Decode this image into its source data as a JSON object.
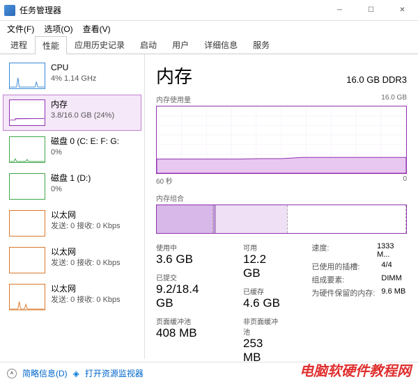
{
  "window": {
    "title": "任务管理器"
  },
  "menu": {
    "file": "文件(F)",
    "options": "选项(O)",
    "view": "查看(V)"
  },
  "tabs": [
    "进程",
    "性能",
    "应用历史记录",
    "启动",
    "用户",
    "详细信息",
    "服务"
  ],
  "active_tab": 1,
  "sidebar": [
    {
      "name": "CPU",
      "val": "4% 1.14 GHz",
      "color": "#3a88d6"
    },
    {
      "name": "内存",
      "val": "3.8/16.0 GB (24%)",
      "color": "#9030b0",
      "selected": true
    },
    {
      "name": "磁盘 0 (C: E: F: G:",
      "val": "0%",
      "color": "#3fa648"
    },
    {
      "name": "磁盘 1 (D:)",
      "val": "0%",
      "color": "#3fa648"
    },
    {
      "name": "以太网",
      "val": "发送: 0 接收: 0 Kbps",
      "color": "#d9772b"
    },
    {
      "name": "以太网",
      "val": "发送: 0 接收: 0 Kbps",
      "color": "#d9772b"
    },
    {
      "name": "以太网",
      "val": "发送: 0 接收: 0 Kbps",
      "color": "#d9772b"
    }
  ],
  "detail": {
    "title": "内存",
    "spec": "16.0 GB DDR3",
    "usage_label": "内存使用量",
    "usage_max": "16.0 GB",
    "axis_left": "60 秒",
    "axis_right": "0",
    "comp_label": "内存组合"
  },
  "chart_data": {
    "type": "area",
    "title": "内存使用量",
    "xlabel": "60 秒",
    "ylabel": "",
    "ylim": [
      0,
      16.0
    ],
    "x": [
      60,
      55,
      50,
      45,
      40,
      35,
      30,
      25,
      20,
      15,
      10,
      5,
      0
    ],
    "values": [
      3.4,
      3.4,
      3.4,
      3.4,
      3.4,
      3.5,
      3.5,
      3.8,
      3.8,
      3.8,
      3.8,
      3.8,
      3.8
    ],
    "composition": {
      "in_use": 3.6,
      "modified": 0.2,
      "standby": 4.6,
      "free": 7.6,
      "total": 16.0
    }
  },
  "stats": {
    "left": [
      {
        "label": "使用中",
        "val": "3.6 GB"
      },
      {
        "label": "已提交",
        "val": "9.2/18.4 GB"
      },
      {
        "label": "页面缓冲池",
        "val": "408 MB"
      }
    ],
    "mid": [
      {
        "label": "可用",
        "val": "12.2 GB"
      },
      {
        "label": "已缓存",
        "val": "4.6 GB"
      },
      {
        "label": "非页面缓冲池",
        "val": "253 MB"
      }
    ],
    "right": [
      {
        "label": "速度:",
        "val": "1333 M..."
      },
      {
        "label": "已使用的插槽:",
        "val": "4/4"
      },
      {
        "label": "组成要素:",
        "val": "DIMM"
      },
      {
        "label": "为硬件保留的内存:",
        "val": "9.6 MB"
      }
    ]
  },
  "footer": {
    "brief": "简略信息(D)",
    "resmon": "打开资源监视器"
  },
  "watermark": "电脑软硬件教程网"
}
